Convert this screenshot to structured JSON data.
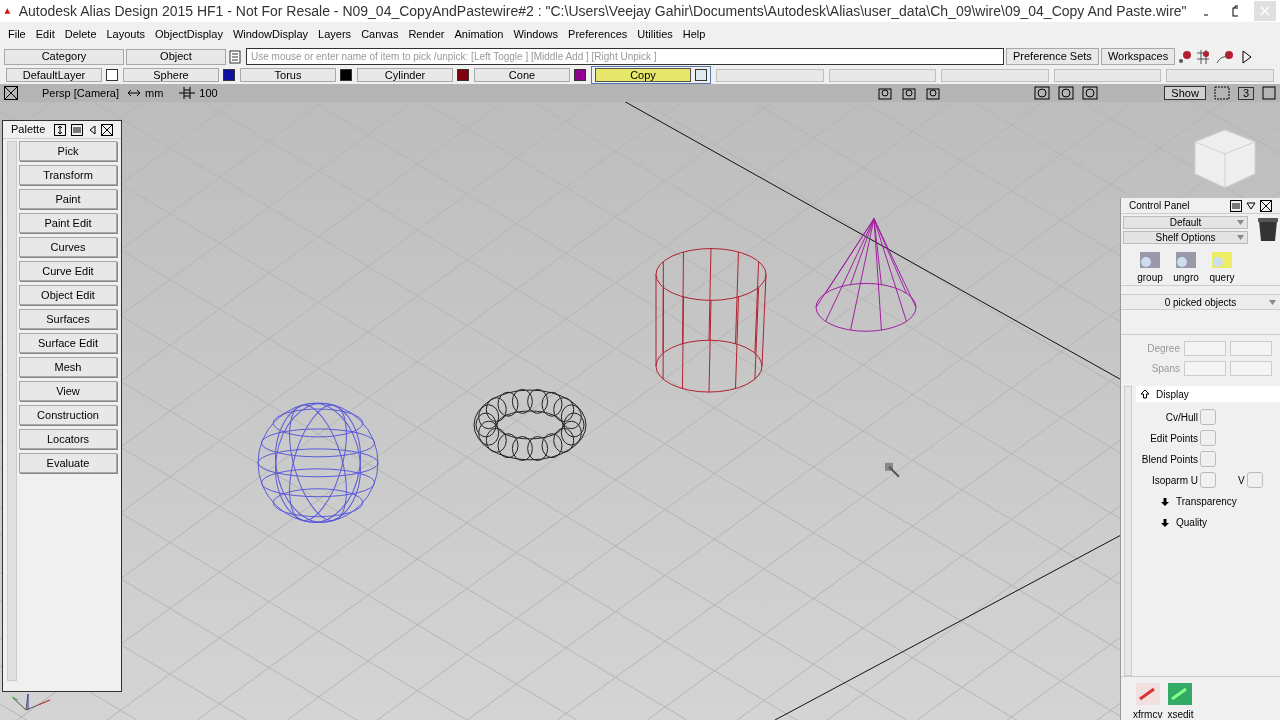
{
  "window": {
    "title": "Autodesk Alias Design 2015 HF1 - Not For Resale    - N09_04_CopyAndPastewire#2 : \"C:\\Users\\Veejay Gahir\\Documents\\Autodesk\\Alias\\user_data\\Ch_09\\wire\\09_04_Copy And Paste.wire\""
  },
  "menu": [
    "File",
    "Edit",
    "Delete",
    "Layouts",
    "ObjectDisplay",
    "WindowDisplay",
    "Layers",
    "Canvas",
    "Render",
    "Animation",
    "Windows",
    "Preferences",
    "Utilities",
    "Help"
  ],
  "pick_bar": {
    "category": "Category",
    "object": "Object",
    "prompt": {
      "placeholder": "Use mouse or enter name of item to pick /unpick: [Left Toggle ] [Middle Add ] [Right Unpick ]"
    },
    "buttons": [
      "Preference Sets",
      "Workspaces"
    ]
  },
  "layers": [
    {
      "name": "DefaultLayer",
      "color": "#ffffff",
      "selected": false
    },
    {
      "name": "Sphere",
      "color": "#1010a0",
      "selected": false
    },
    {
      "name": "Torus",
      "color": "#000000",
      "selected": false
    },
    {
      "name": "Cylinder",
      "color": "#800010",
      "selected": false
    },
    {
      "name": "Cone",
      "color": "#900090",
      "selected": false
    },
    {
      "name": "Copy",
      "color": "#e0e8f0",
      "selected": true
    }
  ],
  "view_bar": {
    "camera": "Persp [Camera]",
    "units": "mm",
    "grid": "100",
    "show": "Show",
    "count": "3"
  },
  "palette": {
    "title": "Palette",
    "items": [
      "Pick",
      "Transform",
      "Paint",
      "Paint Edit",
      "Curves",
      "Curve Edit",
      "Object Edit",
      "Surfaces",
      "Surface Edit",
      "Mesh",
      "View",
      "Construction",
      "Locators",
      "Evaluate"
    ]
  },
  "control_panel": {
    "title": "Control Panel",
    "dropdowns": [
      "Default",
      "Shelf Options"
    ],
    "shelf": [
      "group",
      "ungro",
      "query"
    ],
    "picked": "0 picked objects",
    "fields": [
      "Degree",
      "Spans"
    ],
    "sections": [
      {
        "label": "Display",
        "expanded": true,
        "options": [
          {
            "label": "Cv/Hull",
            "checked": false
          },
          {
            "label": "Edit Points",
            "checked": false
          },
          {
            "label": "Blend Points",
            "checked": false
          },
          {
            "label": "Isoparm U",
            "checked": false
          },
          {
            "label": "V",
            "checked": false
          }
        ]
      },
      {
        "label": "Transparency",
        "expanded": false
      },
      {
        "label": "Quality",
        "expanded": false
      }
    ],
    "bottom_shelf": [
      "xfrmcv",
      "xsedit"
    ]
  }
}
